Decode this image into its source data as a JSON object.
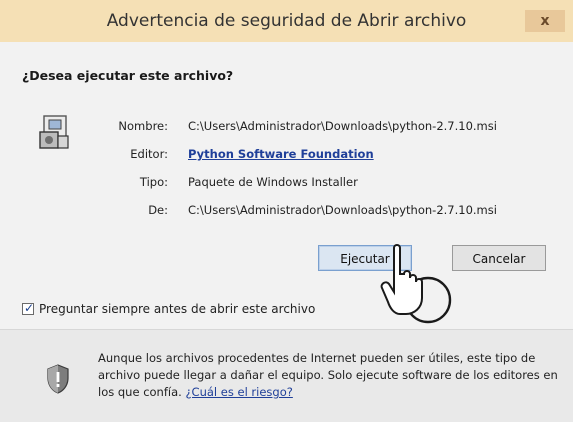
{
  "window": {
    "title": "Advertencia de seguridad de Abrir archivo",
    "close_label": "x"
  },
  "dialog": {
    "question": "¿Desea ejecutar este archivo?",
    "details": [
      {
        "label": "Nombre:",
        "value": "C:\\Users\\Administrador\\Downloads\\python-2.7.10.msi"
      },
      {
        "label": "Editor:",
        "value": "Python Software Foundation"
      },
      {
        "label": "Tipo:",
        "value": "Paquete de Windows Installer"
      },
      {
        "label": "De:",
        "value": "C:\\Users\\Administrador\\Downloads\\python-2.7.10.msi"
      }
    ],
    "run_button": "Ejecutar",
    "cancel_button": "Cancelar",
    "always_ask": {
      "label": "Preguntar siempre antes de abrir este archivo",
      "checked": true
    },
    "warning": {
      "text": "Aunque los archivos procedentes de Internet pueden ser útiles, este tipo de archivo puede llegar a dañar el equipo. Solo ejecute software de los editores en los que confía.",
      "link": "¿Cuál es el riesgo?"
    }
  },
  "icons": {
    "file": "installer-file-icon",
    "shield": "shield-warning-icon",
    "cursor": "hand-cursor-icon"
  },
  "colors": {
    "titlebar": "#f5e0b5",
    "link": "#1f3f99",
    "run_button_accent": "#7aa0cf"
  }
}
